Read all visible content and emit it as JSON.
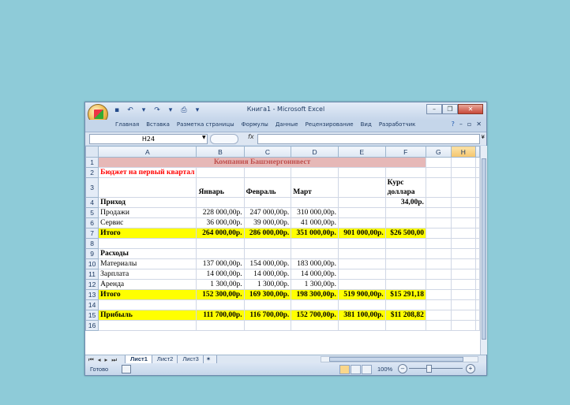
{
  "window": {
    "title": "Книга1 - Microsoft Excel",
    "min_icon": "minimize-icon",
    "max_icon": "restore-icon",
    "close_icon": "close-icon"
  },
  "ribbon": {
    "tabs": [
      "Главная",
      "Вставка",
      "Разметка страницы",
      "Формулы",
      "Данные",
      "Рецензирование",
      "Вид",
      "Разработчик"
    ]
  },
  "formula_bar": {
    "name_box": "H24",
    "fx": "fx",
    "formula": ""
  },
  "columns": [
    "A",
    "B",
    "C",
    "D",
    "E",
    "F",
    "G",
    "H"
  ],
  "selected_column": "H",
  "rows": [
    {
      "n": "1",
      "c": [
        "Компания Башэнергоинвест",
        "",
        "",
        "",
        "",
        "",
        "",
        ""
      ]
    },
    {
      "n": "2",
      "c": [
        "Бюджет на первый квартал",
        "",
        "",
        "",
        "",
        "",
        "",
        ""
      ]
    },
    {
      "n": "3",
      "c": [
        "",
        "Январь",
        "Февраль",
        "Март",
        "",
        "Курс доллара",
        "",
        ""
      ]
    },
    {
      "n": "4",
      "c": [
        "Приход",
        "",
        "",
        "",
        "",
        "34,00р.",
        "",
        ""
      ]
    },
    {
      "n": "5",
      "c": [
        "Продажи",
        "228 000,00р.",
        "247 000,00р.",
        "310 000,00р.",
        "",
        "",
        "",
        ""
      ]
    },
    {
      "n": "6",
      "c": [
        "Сервис",
        "36 000,00р.",
        "39 000,00р.",
        "41 000,00р.",
        "",
        "",
        "",
        ""
      ]
    },
    {
      "n": "7",
      "c": [
        "Итого",
        "264 000,00р.",
        "286 000,00р.",
        "351 000,00р.",
        "901 000,00р.",
        "$26 500,00",
        "",
        ""
      ]
    },
    {
      "n": "8",
      "c": [
        "",
        "",
        "",
        "",
        "",
        "",
        "",
        ""
      ]
    },
    {
      "n": "9",
      "c": [
        "Расходы",
        "",
        "",
        "",
        "",
        "",
        "",
        ""
      ]
    },
    {
      "n": "10",
      "c": [
        "Материалы",
        "137 000,00р.",
        "154 000,00р.",
        "183 000,00р.",
        "",
        "",
        "",
        ""
      ]
    },
    {
      "n": "11",
      "c": [
        "Зарплата",
        "14 000,00р.",
        "14 000,00р.",
        "14 000,00р.",
        "",
        "",
        "",
        ""
      ]
    },
    {
      "n": "12",
      "c": [
        "Аренда",
        "1 300,00р.",
        "1 300,00р.",
        "1 300,00р.",
        "",
        "",
        "",
        ""
      ]
    },
    {
      "n": "13",
      "c": [
        "Итого",
        "152 300,00р.",
        "169 300,00р.",
        "198 300,00р.",
        "519 900,00р.",
        "$15 291,18",
        "",
        ""
      ]
    },
    {
      "n": "14",
      "c": [
        "",
        "",
        "",
        "",
        "",
        "",
        "",
        ""
      ]
    },
    {
      "n": "15",
      "c": [
        "Прибыль",
        "111 700,00р.",
        "116 700,00р.",
        "152 700,00р.",
        "381 100,00р.",
        "$11 208,82",
        "",
        ""
      ]
    },
    {
      "n": "16",
      "c": [
        "",
        "",
        "",
        "",
        "",
        "",
        "",
        ""
      ]
    }
  ],
  "sheets": [
    "Лист1",
    "Лист2",
    "Лист3"
  ],
  "active_sheet": "Лист1",
  "status": {
    "ready": "Готово",
    "zoom": "100%"
  },
  "colors": {
    "title_fill": "#e6b8b7",
    "title_text": "#c0504d",
    "total_fill": "#ffff00",
    "subtitle_text": "#ff0000"
  }
}
